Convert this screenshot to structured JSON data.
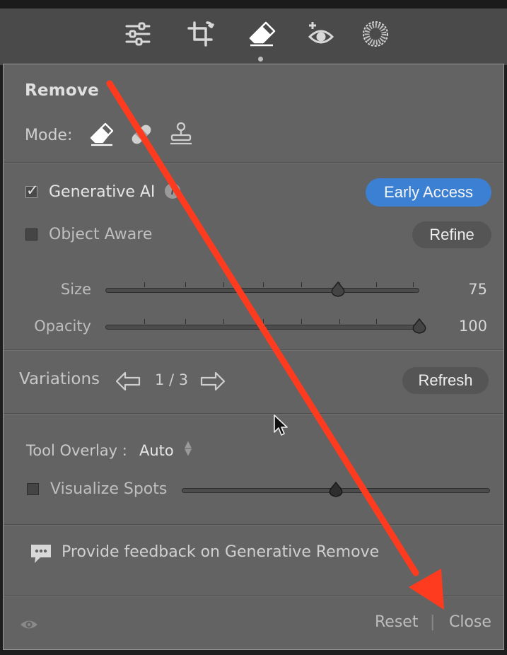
{
  "toolbar": {
    "tools": [
      {
        "name": "edit-sliders-icon"
      },
      {
        "name": "crop-icon"
      },
      {
        "name": "eraser-icon",
        "active": true
      },
      {
        "name": "red-eye-icon"
      },
      {
        "name": "masking-icon"
      }
    ]
  },
  "panel": {
    "title": "Remove",
    "mode_label": "Mode:",
    "modes": [
      "eraser-mode-icon",
      "bandage-mode-icon",
      "clone-stamp-mode-icon"
    ]
  },
  "generative_ai": {
    "label": "Generative AI",
    "checked": true,
    "info_glyph": "i",
    "early_access_label": "Early Access"
  },
  "object_aware": {
    "label": "Object Aware",
    "checked": false,
    "refine_label": "Refine"
  },
  "sliders": {
    "size": {
      "label": "Size",
      "value": "75",
      "fraction": 0.74
    },
    "opacity": {
      "label": "Opacity",
      "value": "100",
      "fraction": 1.0
    }
  },
  "variations": {
    "label": "Variations",
    "current": "1 / 3",
    "refresh_label": "Refresh"
  },
  "tool_overlay": {
    "label": "Tool Overlay :",
    "value": "Auto"
  },
  "visualize_spots": {
    "label": "Visualize Spots",
    "checked": false,
    "fraction": 0.5
  },
  "feedback": {
    "text": "Provide feedback on Generative Remove"
  },
  "footer": {
    "reset_label": "Reset",
    "separator": "|",
    "close_label": "Close"
  },
  "colors": {
    "accent_blue": "#3b80d2",
    "annotation_red": "#ff3b1f",
    "panel_bg": "#636363"
  }
}
